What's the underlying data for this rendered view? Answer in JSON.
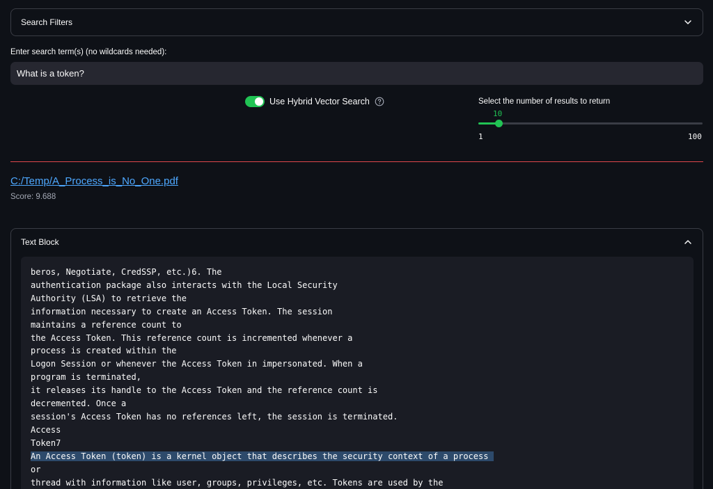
{
  "filters": {
    "title": "Search Filters"
  },
  "search": {
    "label": "Enter search term(s) (no wildcards needed):",
    "value": "What is a token?"
  },
  "hybrid": {
    "label": "Use Hybrid Vector Search",
    "enabled": true
  },
  "slider": {
    "label": "Select the number of results to return",
    "value": "10",
    "min": "1",
    "max": "100",
    "fill_fraction": 0.09
  },
  "result": {
    "link": "C:/Temp/A_Process_is_No_One.pdf",
    "score": "Score: 9.688"
  },
  "textblock": {
    "title": "Text Block",
    "lines": [
      "beros, Negotiate, CredSSP, etc.)6. The",
      "authentication package also interacts with the Local Security",
      "Authority (LSA) to retrieve the",
      "information necessary to create an Access Token. The session",
      "maintains a reference count to",
      "the Access Token. This reference count is incremented whenever a",
      "process is created within the",
      "Logon Session or whenever the Access Token in impersonated. When a",
      "program is terminated,",
      "it releases its handle to the Access Token and the reference count is",
      "decremented. Once a",
      "session's Access Token has no references left, the session is terminated.",
      "Access",
      "Token7",
      "An Access Token (token) is a kernel object that describes the security context of a process ",
      "or",
      "thread with information like user, groups, privileges, etc. Tokens are used by the"
    ],
    "highlight_index": 14
  },
  "colors": {
    "background": "#0e1117",
    "accent": "#21c354",
    "divider": "#e0474c",
    "link": "#4ea8ff",
    "highlight": "#2d4a6b"
  }
}
